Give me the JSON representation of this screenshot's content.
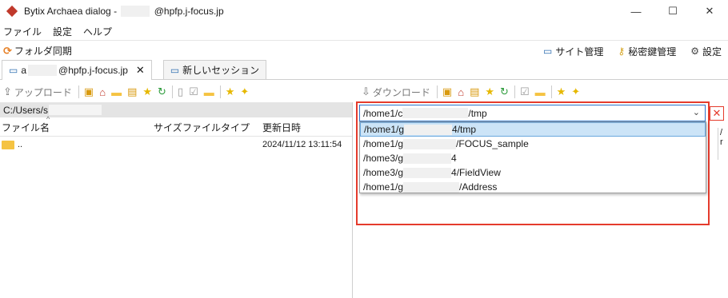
{
  "window": {
    "title_prefix": "Bytix Archaea dialog -",
    "title_suffix": "@hpfp.j-focus.jp",
    "controls": [
      "—",
      "☐",
      "✕"
    ]
  },
  "menu": {
    "items": [
      "ファイル",
      "設定",
      "ヘルプ"
    ]
  },
  "toolbar": {
    "sync_label": "フォルダ同期",
    "site_manager": "サイト管理",
    "key_manager": "秘密鍵管理",
    "settings": "設定"
  },
  "tabs": [
    {
      "label_prefix": "a",
      "label_suffix": "@hpfp.j-focus.jp",
      "close": "✕",
      "active": true
    },
    {
      "label": "新しいセッション",
      "active": false
    }
  ],
  "left": {
    "upload_label": "アップロード",
    "path": "C:/Users/s",
    "columns": {
      "name": "ファイル名",
      "size": "サイズ",
      "type": "ファイルタイプ",
      "modified": "更新日時"
    },
    "rows": [
      {
        "name": "..",
        "modified": "2024/11/12 13:11:54"
      }
    ]
  },
  "right": {
    "download_label": "ダウンロード",
    "combo": {
      "prefix": "/home1/c",
      "suffix": "/tmp"
    },
    "dropdown": [
      {
        "prefix": "/home1/g",
        "suffix": "4/tmp",
        "selected": true
      },
      {
        "prefix": "/home1/g",
        "suffix": "/FOCUS_sample",
        "selected": false
      },
      {
        "prefix": "/home3/g",
        "suffix": "4",
        "selected": false
      },
      {
        "prefix": "/home3/g",
        "suffix": "4/FieldView",
        "selected": false
      },
      {
        "prefix": "/home1/g",
        "suffix": "/Address",
        "selected": false
      }
    ],
    "cut_col": [
      "/",
      "r"
    ]
  },
  "colors": {
    "accent_red": "#e53b2c",
    "selection": "#cce4f7",
    "folder": "#f5c342"
  },
  "icons": {
    "panel_tools": [
      "new-folder-icon",
      "home-icon",
      "folder-icon",
      "terminal-icon",
      "star-icon",
      "refresh-icon",
      "document-icon",
      "checklist-icon",
      "add-folder-icon",
      "add-bookmark-icon",
      "bookmarks-icon"
    ]
  }
}
